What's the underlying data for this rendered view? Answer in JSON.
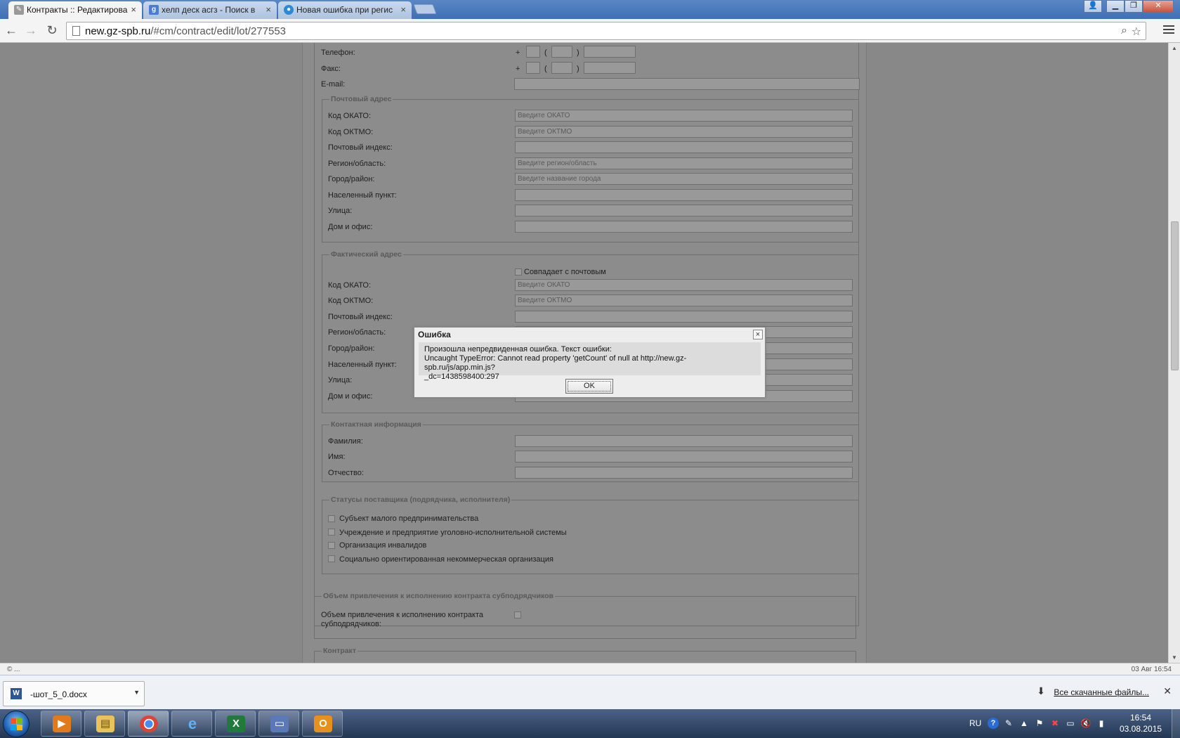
{
  "browser": {
    "tabs": [
      {
        "title": "Контракты :: Редактирова",
        "active": true,
        "icon": "wrench-icon"
      },
      {
        "title": "хелп деск асгз - Поиск в",
        "active": false,
        "icon": "google-icon"
      },
      {
        "title": "Новая ошибка при регис",
        "active": false,
        "icon": "globe-icon"
      }
    ],
    "url_host": "new.gz-spb.ru",
    "url_path": "/#cm/contract/edit/lot/277553",
    "window_buttons": [
      "▁",
      "❐",
      "✕"
    ]
  },
  "form": {
    "phone_label": "Телефон:",
    "fax_label": "Факс:",
    "email_label": "E-mail:",
    "plus": "+",
    "open_paren": "(",
    "close_paren": ")",
    "postal_address": {
      "legend": "Почтовый адрес",
      "fields": [
        {
          "label": "Код ОКАТО:",
          "placeholder": "Введите ОКАТО"
        },
        {
          "label": "Код ОКТМО:",
          "placeholder": "Введите ОКТМО"
        },
        {
          "label": "Почтовый индекс:",
          "placeholder": ""
        },
        {
          "label": "Регион/область:",
          "placeholder": "Введите регион/область"
        },
        {
          "label": "Город/район:",
          "placeholder": "Введите название города"
        },
        {
          "label": "Населенный пункт:",
          "placeholder": ""
        },
        {
          "label": "Улица:",
          "placeholder": ""
        },
        {
          "label": "Дом и офис:",
          "placeholder": ""
        }
      ]
    },
    "actual_address": {
      "legend": "Фактический адрес",
      "same_as_postal": "Совпадает с почтовым",
      "fields": [
        {
          "label": "Код ОКАТО:",
          "placeholder": "Введите ОКАТО"
        },
        {
          "label": "Код ОКТМО:",
          "placeholder": "Введите ОКТМО"
        },
        {
          "label": "Почтовый индекс:",
          "placeholder": ""
        },
        {
          "label": "Регион/область:",
          "placeholder": ""
        },
        {
          "label": "Город/район:",
          "placeholder": ""
        },
        {
          "label": "Населенный пункт:",
          "placeholder": ""
        },
        {
          "label": "Улица:",
          "placeholder": ""
        },
        {
          "label": "Дом и офис:",
          "placeholder": ""
        }
      ]
    },
    "contact_info": {
      "legend": "Контактная информация",
      "fields": [
        {
          "label": "Фамилия:"
        },
        {
          "label": "Имя:"
        },
        {
          "label": "Отчество:"
        }
      ]
    },
    "supplier_statuses": {
      "legend": "Статусы поставщика (подрядчика, исполнителя)",
      "options": [
        "Субъект малого предпринимательства",
        "Учреждение и предприятие уголовно-исполнительной системы",
        "Организация инвалидов",
        "Социально ориентированная некоммерческая организация"
      ]
    },
    "subcontract": {
      "legend": "Объем привлечения к исполнению контракта субподрядчиков",
      "label_line1": "Объем привлечения к исполнению контракта",
      "label_line2": "субподрядчиков:"
    },
    "contract_legend": "Контракт"
  },
  "modal": {
    "title": "Ошибка",
    "close": "×",
    "line1": "Произошла непредвиденная ошибка. Текст ошибки:",
    "line2": "Uncaught TypeError: Cannot read property 'getCount' of null at http://new.gz-spb.ru/js/app.min.js?",
    "line3": "_dc=1438598400:297",
    "ok_label": "OK"
  },
  "statusbar": {
    "left": "© ...",
    "right": "03 Авг 16:54"
  },
  "downloads": {
    "file_name": "-шот_5_0.docx",
    "all_downloads": "Все скачанные файлы...",
    "close": "✕"
  },
  "taskbar": {
    "lang": "RU",
    "help": "?",
    "time": "16:54",
    "date": "03.08.2015"
  },
  "colors": {
    "overlay": "#888888",
    "tab_active": "#f4f4f4",
    "taskbar": "#233753"
  }
}
